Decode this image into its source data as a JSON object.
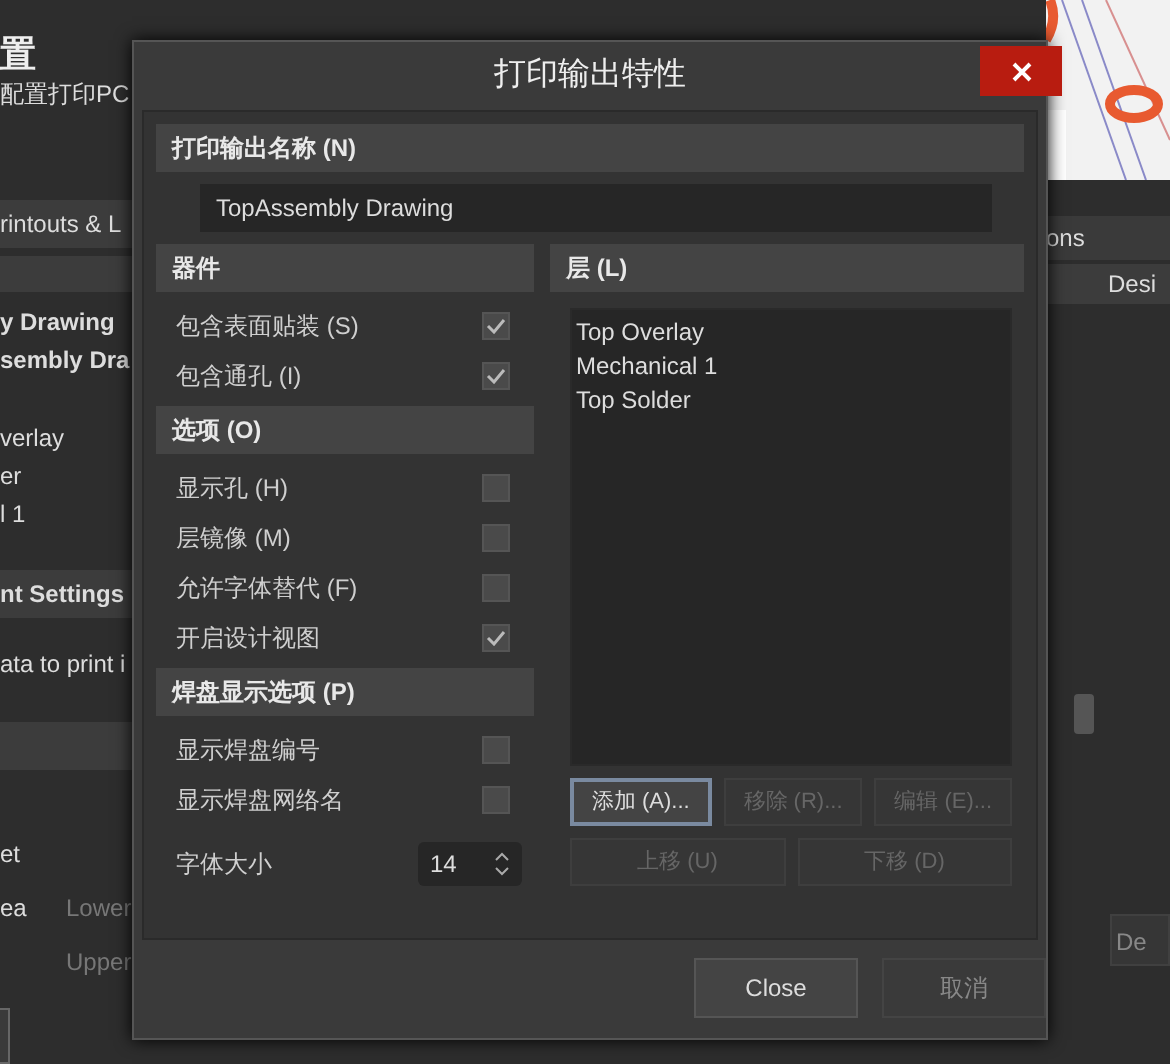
{
  "background_window": {
    "title": "置",
    "subtitle": "配置打印PC",
    "tab": "rintouts & L",
    "left_items": [
      {
        "text": "y Drawing",
        "kind": "bold"
      },
      {
        "text": "sembly Dra",
        "kind": "bold"
      },
      {
        "text": "verlay",
        "kind": "plain"
      },
      {
        "text": "er",
        "kind": "plain"
      },
      {
        "text": "l 1",
        "kind": "plain"
      }
    ],
    "section": "nt Settings",
    "description": "ata to print i",
    "options": [
      {
        "label": "et"
      },
      {
        "label": "ea",
        "field": "Lower"
      },
      {
        "field": "Upper"
      }
    ],
    "right_tab": "ons",
    "right_column": "Desi",
    "right_button": "De"
  },
  "dialog": {
    "title": "打印输出特性",
    "name_header": "打印输出名称 (N)",
    "name_value": "TopAssembly Drawing",
    "sections": [
      {
        "header": "器件",
        "rows": [
          {
            "label": "包含表面贴装 (S)",
            "checked": true
          },
          {
            "label": "包含通孔 (I)",
            "checked": true
          }
        ]
      },
      {
        "header": "选项 (O)",
        "rows": [
          {
            "label": "显示孔 (H)",
            "checked": false
          },
          {
            "label": "层镜像 (M)",
            "checked": false
          },
          {
            "label": "允许字体替代 (F)",
            "checked": false
          },
          {
            "label": "开启设计视图",
            "checked": true
          }
        ]
      },
      {
        "header": "焊盘显示选项 (P)",
        "rows": [
          {
            "label": "显示焊盘编号",
            "checked": false
          },
          {
            "label": "显示焊盘网络名",
            "checked": false
          }
        ]
      }
    ],
    "font_size": {
      "label": "字体大小",
      "value": "14"
    },
    "layers_header": "层 (L)",
    "layers": [
      "Top Overlay",
      "Mechanical 1",
      "Top Solder"
    ],
    "layer_buttons": [
      {
        "label": "添加 (A)...",
        "disabled": false
      },
      {
        "label": "移除 (R)...",
        "disabled": true
      },
      {
        "label": "编辑 (E)...",
        "disabled": true
      }
    ],
    "move_buttons": [
      {
        "label": "上移 (U)",
        "disabled": true
      },
      {
        "label": "下移 (D)",
        "disabled": true
      }
    ],
    "footer_buttons": [
      {
        "label": "Close",
        "disabled": false
      },
      {
        "label": "取消",
        "disabled": false
      }
    ]
  }
}
